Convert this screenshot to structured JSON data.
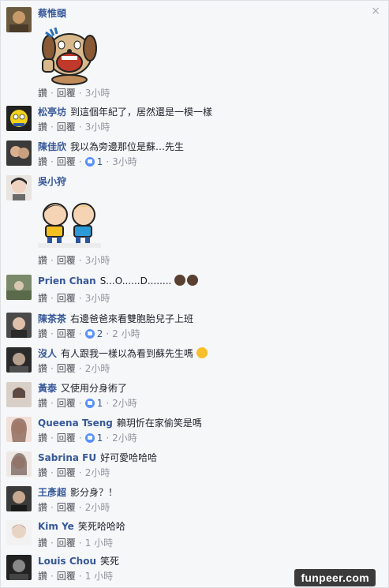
{
  "close_label": "×",
  "comments": [
    {
      "name": "蔡惟頤",
      "text": "",
      "like": "讚",
      "reply": "回覆",
      "time": "3小時",
      "likes": ""
    },
    {
      "name": "松亭坊",
      "text": "到這個年紀了，居然還是一模一樣",
      "like": "讚",
      "reply": "回覆",
      "time": "3小時",
      "likes": ""
    },
    {
      "name": "陳佳欣",
      "text": "我以為旁邊那位是蘇…先生",
      "like": "讚",
      "reply": "回覆",
      "time": "3小時",
      "likes": "1"
    },
    {
      "name": "吳小狩",
      "text": "",
      "like": "讚",
      "reply": "回覆",
      "time": "3小時",
      "likes": ""
    },
    {
      "name": "Prien Chan",
      "text": "S...O......D........",
      "like": "讚",
      "reply": "回覆",
      "time": "3小時",
      "likes": ""
    },
    {
      "name": "陳茶茶",
      "text": "右邊爸爸來看雙胞胎兒子上班",
      "like": "讚",
      "reply": "回覆",
      "time": "2 小時",
      "likes": "2"
    },
    {
      "name": "沒人",
      "text": "有人跟我一樣以為看到蘇先生嗎",
      "like": "讚",
      "reply": "回覆",
      "time": "2小時",
      "likes": ""
    },
    {
      "name": "黃泰",
      "text": "又使用分身術了",
      "like": "讚",
      "reply": "回覆",
      "time": "2小時",
      "likes": "1"
    },
    {
      "name": "Queena Tseng",
      "text": "賴玥忻在家偷笑是嗎",
      "like": "讚",
      "reply": "回覆",
      "time": "2小時",
      "likes": "1"
    },
    {
      "name": "Sabrina FU",
      "text": "好可愛哈哈哈",
      "like": "讚",
      "reply": "回覆",
      "time": "2小時",
      "likes": ""
    },
    {
      "name": "王彥超",
      "text": "影分身？！",
      "like": "讚",
      "reply": "回覆",
      "time": "2小時",
      "likes": ""
    },
    {
      "name": "Kim Ye",
      "text": "笑死哈哈哈",
      "like": "讚",
      "reply": "回覆",
      "time": "1 小時",
      "likes": ""
    },
    {
      "name": "Louis Chou",
      "text": "笑死",
      "like": "讚",
      "reply": "回覆",
      "time": "1 小時",
      "likes": ""
    }
  ],
  "watermark": "funpeer.com",
  "colors": {
    "name": "#365899",
    "text": "#1d2129",
    "muted": "#90949c",
    "like_badge": "#5890ff"
  }
}
